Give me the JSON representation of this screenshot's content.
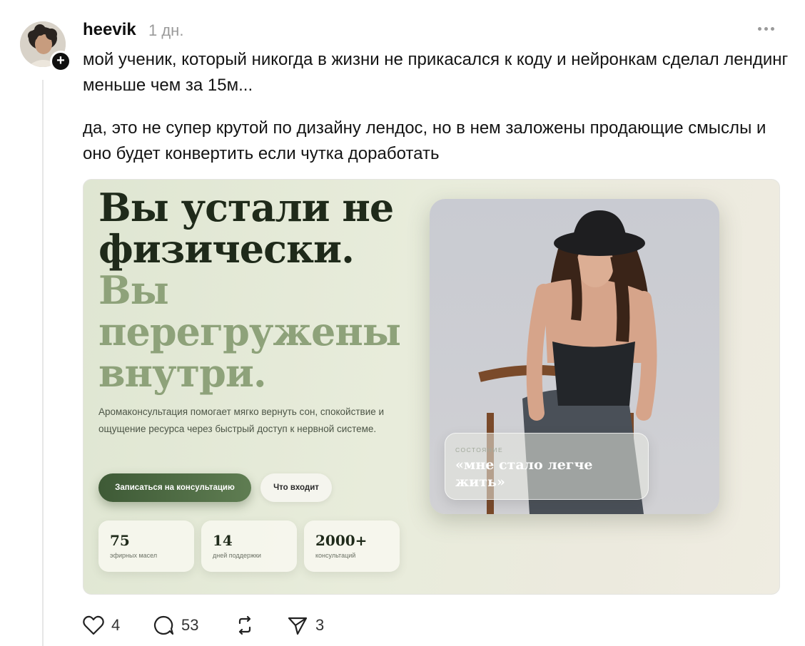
{
  "post": {
    "username": "heevik",
    "timestamp": "1 дн.",
    "paragraphs": [
      "мой ученик, который никогда в жизни не прикасался к коду и нейронкам сделал лендинг меньше чем за 15м...",
      "да, это не супер крутой по дизайну лендос, но в нем заложены продающие смыслы и оно будет конвертить если чутка доработать"
    ]
  },
  "landing": {
    "headline_dark": "Вы устали не физически.",
    "headline_light": "Вы перегружены внутри.",
    "subtitle": "Аромаконсультация помогает мягко вернуть сон, спокойствие и ощущение ресурса через быстрый доступ к нервной системе.",
    "primary_button": "Записаться на консультацию",
    "secondary_button": "Что входит",
    "stats": [
      {
        "value": "75",
        "label": "эфирных масел"
      },
      {
        "value": "14",
        "label": "дней поддержки"
      },
      {
        "value": "2000+",
        "label": "консультаций"
      }
    ],
    "card_eyebrow": "СОСТОЯНИЕ",
    "card_quote": "«мне стало легче жить»"
  },
  "actions": {
    "likes": "4",
    "replies": "53",
    "shares": "3"
  },
  "icons": {
    "more": "more-horizontal-icon",
    "like": "heart-icon",
    "reply": "comment-icon",
    "repost": "repost-icon",
    "share": "send-icon",
    "follow": "plus-icon"
  }
}
